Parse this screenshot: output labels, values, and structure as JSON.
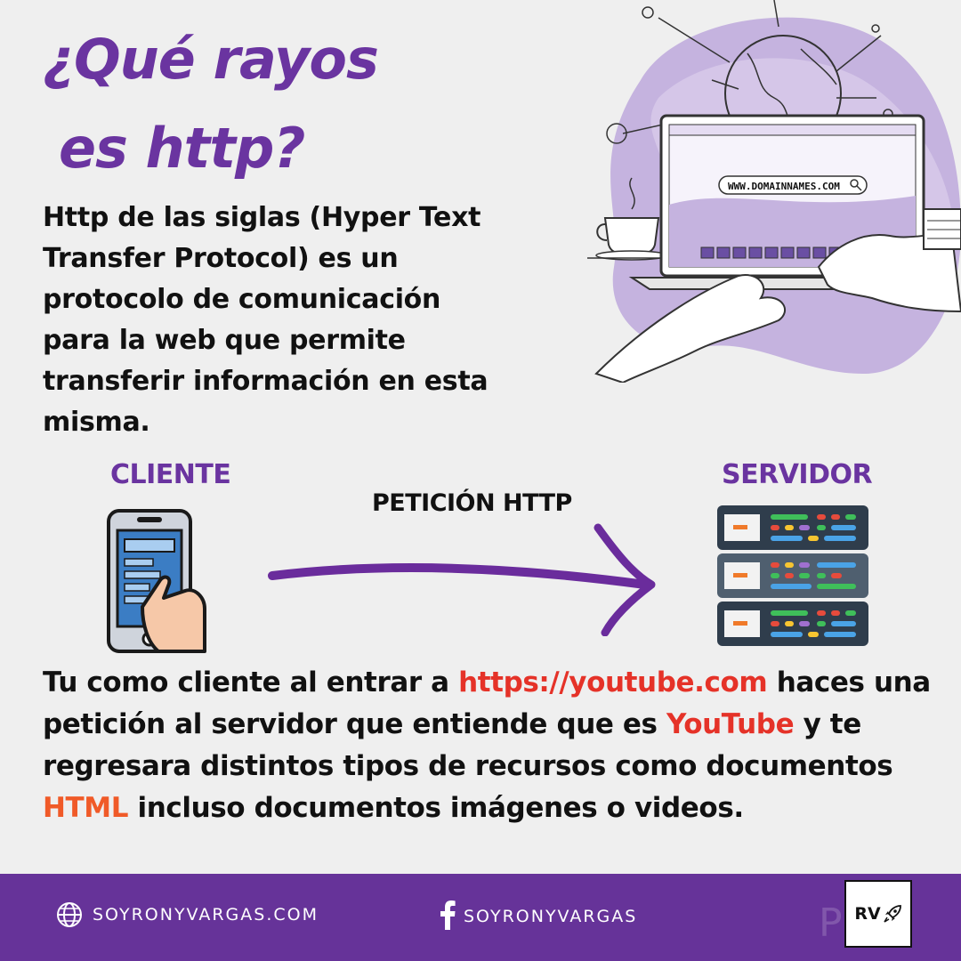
{
  "title": {
    "line1": "¿Qué rayos",
    "line2": "es http?"
  },
  "intro": "Http de las siglas (Hyper Text Transfer Protocol) es un protocolo de comunicación para la web que permite transferir información en esta misma.",
  "illustration": {
    "url_bar": "WWW.DOMAINNAMES.COM"
  },
  "diagram": {
    "client_label": "CLIENTE",
    "server_label": "SERVIDOR",
    "arrow_label": "PETICIÓN HTTP"
  },
  "body": {
    "part1": "Tu como cliente al entrar a ",
    "link": "https://youtube.com",
    "part2": " haces una petición al servidor que entiende que es ",
    "brand": "YouTube",
    "part3": " y te regresara distintos tipos de recursos como documentos ",
    "html": "HTML",
    "part4": " incluso documentos imágenes o videos."
  },
  "footer": {
    "website": "SOYRONYVARGAS.COM",
    "facebook": "SOYRONYVARGAS",
    "badge": "RV",
    "watermark": "Plu"
  },
  "colors": {
    "brand_purple": "#663399",
    "title_purple": "#6a34a0",
    "link_red": "#e53228",
    "html_orange": "#f05a28",
    "background": "#efefef"
  }
}
